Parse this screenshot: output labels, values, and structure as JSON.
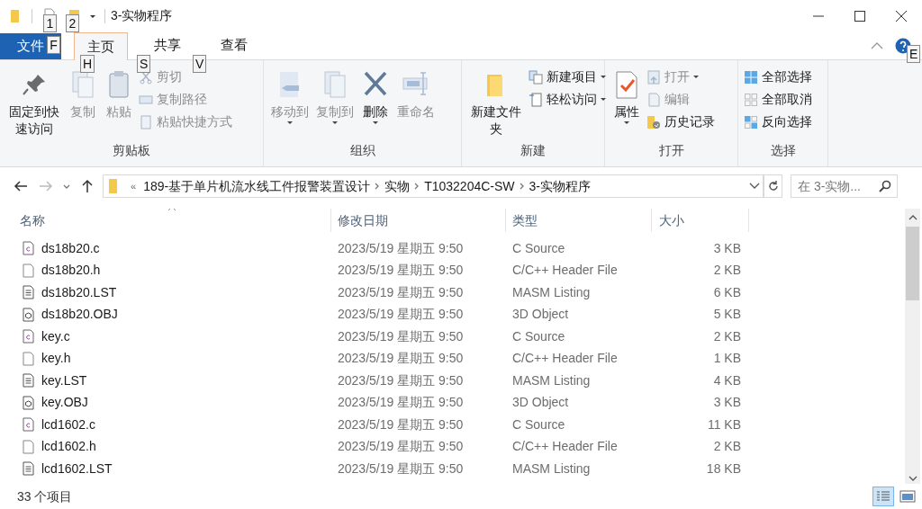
{
  "window": {
    "title": "3-实物程序"
  },
  "keytips": [
    "1",
    "2",
    "F",
    "H",
    "S",
    "V",
    "E"
  ],
  "tabs": [
    {
      "label": "文件",
      "kind": "file",
      "selected": false
    },
    {
      "label": "主页",
      "kind": "tab",
      "selected": true
    },
    {
      "label": "共享",
      "kind": "tab",
      "selected": false
    },
    {
      "label": "查看",
      "kind": "tab",
      "selected": false
    }
  ],
  "ribbon": [
    {
      "label": "剪贴板",
      "columns": [
        [
          {
            "label": "固定到快速访问",
            "kind": "large",
            "disabled": false,
            "dropdown": false
          }
        ],
        [
          {
            "label": "复制",
            "kind": "large",
            "disabled": true,
            "dropdown": false
          }
        ],
        [
          {
            "label": "粘贴",
            "kind": "large",
            "disabled": true,
            "dropdown": false
          }
        ],
        [
          {
            "label": "剪切",
            "kind": "small",
            "disabled": true,
            "dropdown": false
          },
          {
            "label": "复制路径",
            "kind": "small",
            "disabled": true,
            "dropdown": false
          },
          {
            "label": "粘贴快捷方式",
            "kind": "small",
            "disabled": true,
            "dropdown": false
          }
        ]
      ]
    },
    {
      "label": "组织",
      "columns": [
        [
          {
            "label": "移动到",
            "kind": "large",
            "disabled": true,
            "dropdown": true
          }
        ],
        [
          {
            "label": "复制到",
            "kind": "large",
            "disabled": true,
            "dropdown": true
          }
        ],
        [
          {
            "label": "删除",
            "kind": "large",
            "disabled": false,
            "dropdown": true
          }
        ],
        [
          {
            "label": "重命名",
            "kind": "large",
            "disabled": true,
            "dropdown": false
          }
        ]
      ]
    },
    {
      "label": "新建",
      "columns": [
        [
          {
            "label": "新建文件夹",
            "kind": "large",
            "disabled": false,
            "dropdown": false
          }
        ],
        [
          {
            "label": "新建项目",
            "kind": "small",
            "disabled": false,
            "dropdown": true
          },
          {
            "label": "轻松访问",
            "kind": "small",
            "disabled": false,
            "dropdown": true
          }
        ]
      ]
    },
    {
      "label": "打开",
      "columns": [
        [
          {
            "label": "属性",
            "kind": "large",
            "disabled": false,
            "dropdown": true
          }
        ],
        [
          {
            "label": "打开",
            "kind": "small",
            "disabled": true,
            "dropdown": true
          },
          {
            "label": "编辑",
            "kind": "small",
            "disabled": true,
            "dropdown": false
          },
          {
            "label": "历史记录",
            "kind": "small",
            "disabled": false,
            "dropdown": false
          }
        ]
      ]
    },
    {
      "label": "选择",
      "columns": [
        [
          {
            "label": "全部选择",
            "kind": "small",
            "disabled": false,
            "dropdown": false
          },
          {
            "label": "全部取消",
            "kind": "small",
            "disabled": false,
            "dropdown": false
          },
          {
            "label": "反向选择",
            "kind": "small",
            "disabled": false,
            "dropdown": false
          }
        ]
      ]
    }
  ],
  "address": {
    "overflow": "«",
    "crumbs": [
      "189-基于单片机流水线工件报警装置设计",
      "实物",
      "T1032204C-SW",
      "3-实物程序"
    ]
  },
  "search": {
    "placeholder": "在 3-实物..."
  },
  "table": {
    "columns": [
      "名称",
      "修改日期",
      "类型",
      "大小"
    ],
    "rows": [
      {
        "kind": "c",
        "name": "ds18b20.c",
        "modified": "2023/5/19 星期五 9:50",
        "type": "C Source",
        "size": "3 KB"
      },
      {
        "kind": "h",
        "name": "ds18b20.h",
        "modified": "2023/5/19 星期五 9:50",
        "type": "C/C++ Header File",
        "size": "2 KB"
      },
      {
        "kind": "lst",
        "name": "ds18b20.LST",
        "modified": "2023/5/19 星期五 9:50",
        "type": "MASM Listing",
        "size": "6 KB"
      },
      {
        "kind": "obj",
        "name": "ds18b20.OBJ",
        "modified": "2023/5/19 星期五 9:50",
        "type": "3D Object",
        "size": "5 KB"
      },
      {
        "kind": "c",
        "name": "key.c",
        "modified": "2023/5/19 星期五 9:50",
        "type": "C Source",
        "size": "2 KB"
      },
      {
        "kind": "h",
        "name": "key.h",
        "modified": "2023/5/19 星期五 9:50",
        "type": "C/C++ Header File",
        "size": "1 KB"
      },
      {
        "kind": "lst",
        "name": "key.LST",
        "modified": "2023/5/19 星期五 9:50",
        "type": "MASM Listing",
        "size": "4 KB"
      },
      {
        "kind": "obj",
        "name": "key.OBJ",
        "modified": "2023/5/19 星期五 9:50",
        "type": "3D Object",
        "size": "3 KB"
      },
      {
        "kind": "c",
        "name": "lcd1602.c",
        "modified": "2023/5/19 星期五 9:50",
        "type": "C Source",
        "size": "11 KB"
      },
      {
        "kind": "h",
        "name": "lcd1602.h",
        "modified": "2023/5/19 星期五 9:50",
        "type": "C/C++ Header File",
        "size": "2 KB"
      },
      {
        "kind": "lst",
        "name": "lcd1602.LST",
        "modified": "2023/5/19 星期五 9:50",
        "type": "MASM Listing",
        "size": "18 KB"
      }
    ]
  },
  "status_bar": {
    "count": "33 个项目"
  }
}
